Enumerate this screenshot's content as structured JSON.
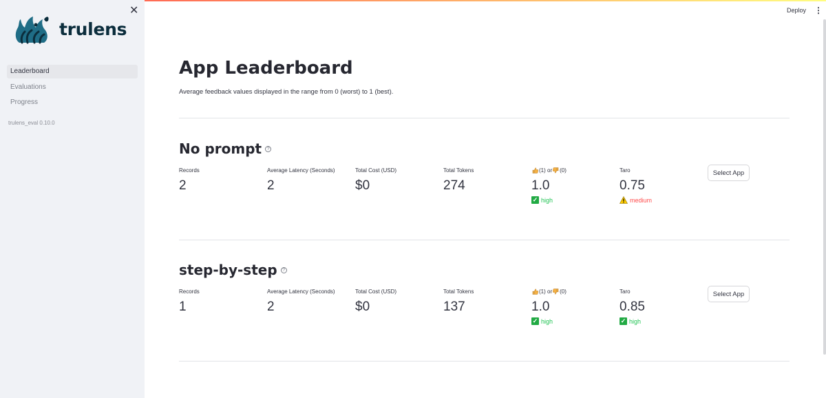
{
  "sidebar": {
    "logo_text": "trulens",
    "nav_items": [
      {
        "label": "Leaderboard",
        "active": true
      },
      {
        "label": "Evaluations",
        "active": false
      },
      {
        "label": "Progress",
        "active": false
      }
    ],
    "version": "trulens_eval 0.10.0",
    "close_icon": "close-icon"
  },
  "header": {
    "deploy_label": "Deploy",
    "menu_icon": "kebab-menu-icon"
  },
  "page": {
    "title": "App Leaderboard",
    "subtitle": "Average feedback values displayed in the range from 0 (worst) to 1 (best)."
  },
  "apps": [
    {
      "name": "No prompt",
      "records_label": "Records",
      "records": "2",
      "latency_label": "Average Latency (Seconds)",
      "latency": "2",
      "cost_label": "Total Cost (USD)",
      "cost": "$0",
      "tokens_label": "Total Tokens",
      "tokens": "274",
      "feedback_label_a": "(1) or",
      "feedback_label_b": "(0)",
      "feedback": "1.0",
      "feedback_delta": "high",
      "taro_label": "Taro",
      "taro": "0.75",
      "taro_delta": "medium",
      "button_label": "Select App"
    },
    {
      "name": "step-by-step",
      "records_label": "Records",
      "records": "1",
      "latency_label": "Average Latency (Seconds)",
      "latency": "2",
      "cost_label": "Total Cost (USD)",
      "cost": "$0",
      "tokens_label": "Total Tokens",
      "tokens": "137",
      "feedback_label_a": "(1) or",
      "feedback_label_b": "(0)",
      "feedback": "1.0",
      "feedback_delta": "high",
      "taro_label": "Taro",
      "taro": "0.85",
      "taro_delta": "high",
      "button_label": "Select App"
    }
  ],
  "colors": {
    "good": "#21c354",
    "warn": "#ff4b4b",
    "sidebar_bg": "#f0f2f6",
    "brand": "#0b2d3c"
  }
}
